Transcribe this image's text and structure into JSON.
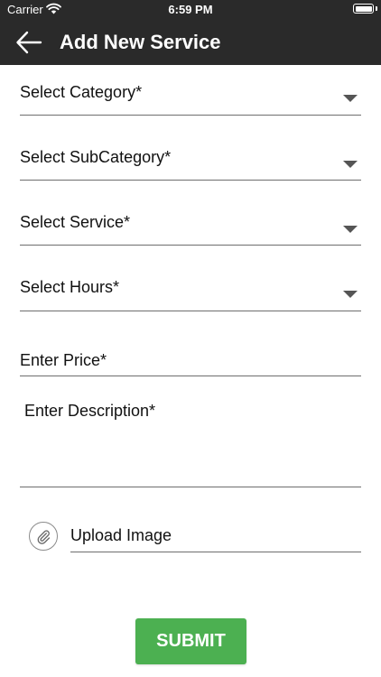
{
  "status_bar": {
    "carrier": "Carrier",
    "time": "6:59 PM"
  },
  "header": {
    "title": "Add New Service"
  },
  "form": {
    "category": "Select Category*",
    "subcategory": "Select SubCategory*",
    "service": "Select Service*",
    "hours": "Select Hours*",
    "price": "Enter Price*",
    "description": "Enter Description*",
    "upload_image": "Upload Image",
    "submit_label": "SUBMIT"
  },
  "colors": {
    "header_bg": "#2a2a2a",
    "submit_bg": "#4cb051"
  }
}
